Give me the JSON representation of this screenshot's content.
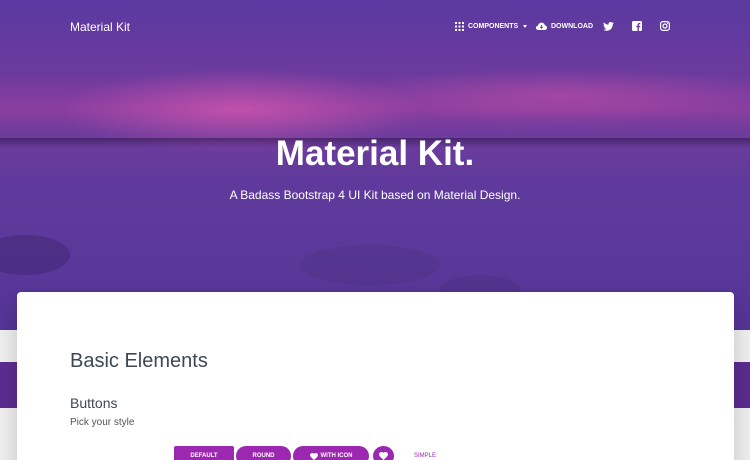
{
  "navbar": {
    "brand": "Material Kit",
    "components_label": "COMPONENTS",
    "download_label": "DOWNLOAD"
  },
  "hero": {
    "title": "Material Kit.",
    "subtitle": "A Badass Bootstrap 4 UI Kit based on Material Design."
  },
  "main": {
    "section_title": "Basic Elements",
    "buttons_title": "Buttons",
    "buttons_desc": "Pick your style",
    "buttons": {
      "default": "DEFAULT",
      "round": "ROUND",
      "with_icon": "WITH ICON",
      "simple": "SIMPLE"
    }
  },
  "colors": {
    "primary": "#9c27b0",
    "text": "#3c4858"
  },
  "icons": [
    "apps-icon",
    "cloud-download-icon",
    "twitter-icon",
    "facebook-icon",
    "instagram-icon",
    "heart-icon"
  ]
}
